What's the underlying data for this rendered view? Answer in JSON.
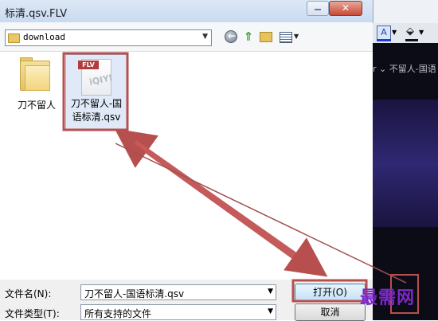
{
  "window": {
    "title": "标清.qsv.FLV"
  },
  "toolbar": {
    "location": "download"
  },
  "files": [
    {
      "name": "刀不留人",
      "type": "folder"
    },
    {
      "name_line1": "刀不留人-国",
      "name_line2": "语标清.qsv",
      "badge": "FLV",
      "logo": "iQIYI",
      "type": "file",
      "selected": true
    }
  ],
  "bottom": {
    "filename_label": "文件名(N):",
    "filename_value": "刀不留人-国语标清.qsv",
    "filetype_label": "文件类型(T):",
    "filetype_value": "所有支持的文件",
    "open_label": "打开(O)",
    "cancel_label": "取消"
  },
  "background_app": {
    "crumb": "r ⌄ 不留人-国语"
  },
  "watermark": "最需网",
  "colors": {
    "annotation": "#b84f4f",
    "watermark": "#7c28c9"
  }
}
